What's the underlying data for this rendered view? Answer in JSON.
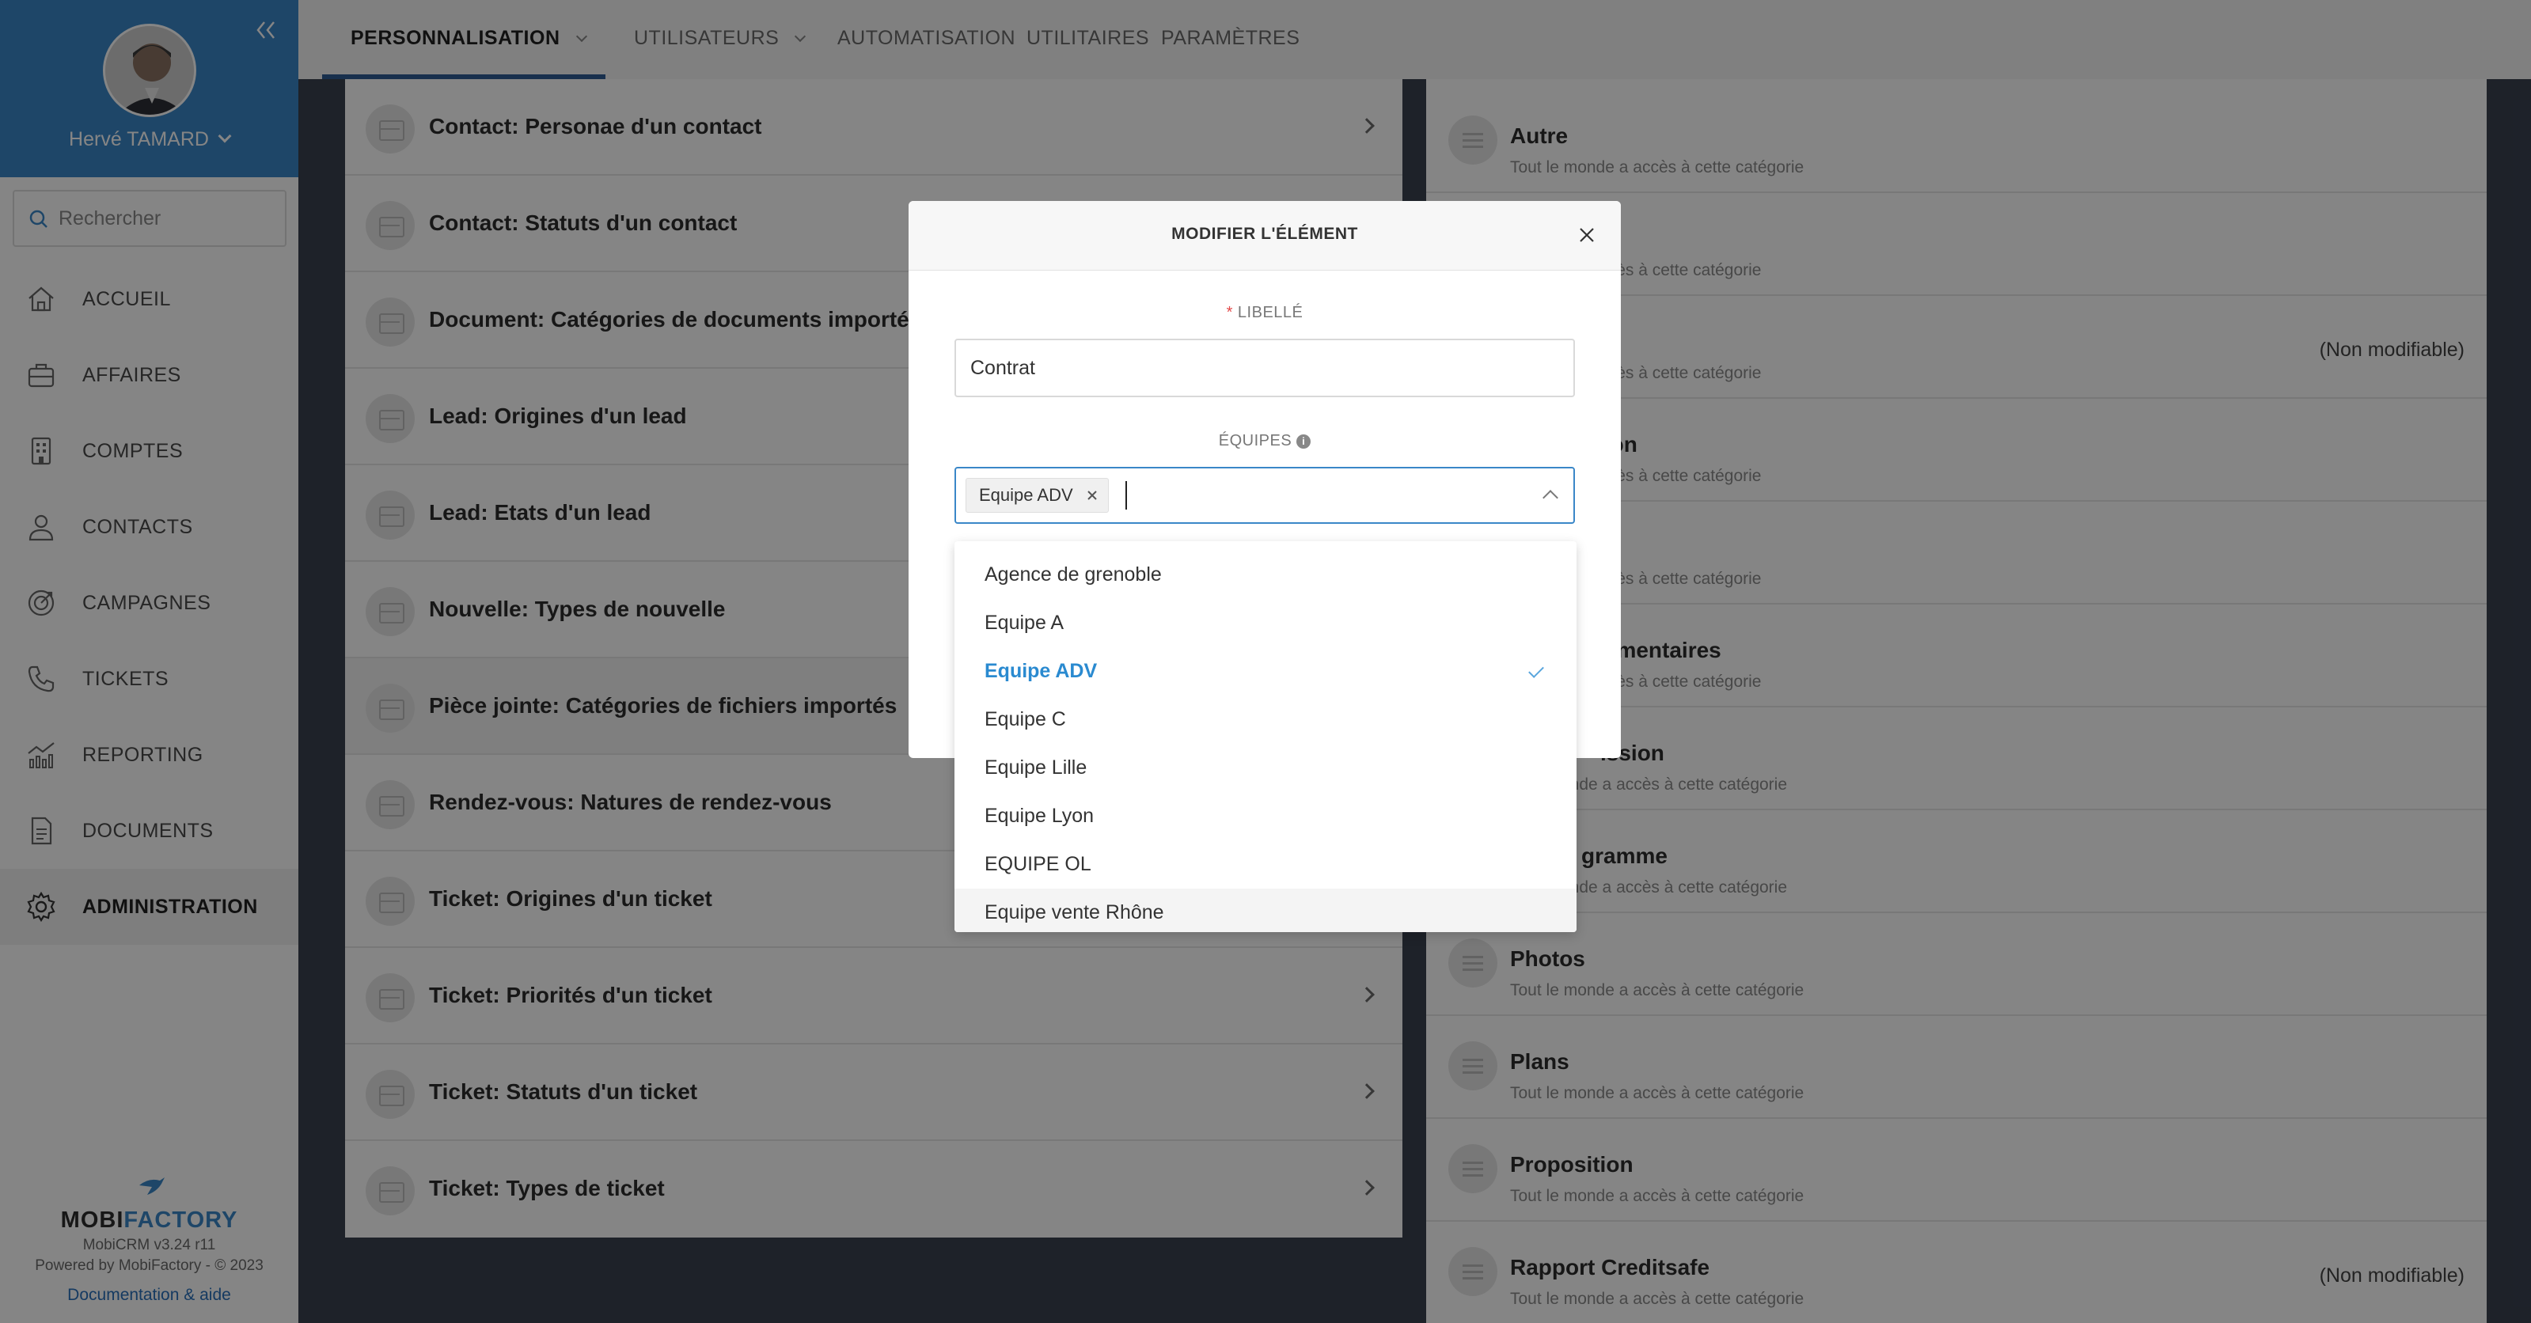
{
  "sidebar": {
    "user": {
      "name": "Hervé TAMARD"
    },
    "search": {
      "placeholder": "Rechercher"
    },
    "nav": [
      {
        "label": "ACCUEIL",
        "icon": "home-icon"
      },
      {
        "label": "AFFAIRES",
        "icon": "briefcase-icon"
      },
      {
        "label": "COMPTES",
        "icon": "building-icon"
      },
      {
        "label": "CONTACTS",
        "icon": "person-icon"
      },
      {
        "label": "CAMPAGNES",
        "icon": "target-icon"
      },
      {
        "label": "TICKETS",
        "icon": "phone-icon"
      },
      {
        "label": "REPORTING",
        "icon": "chart-icon"
      },
      {
        "label": "DOCUMENTS",
        "icon": "document-icon"
      },
      {
        "label": "ADMINISTRATION",
        "icon": "gear-icon",
        "active": true
      }
    ],
    "brand": {
      "name_a": "MOBI",
      "name_b": "FACTORY",
      "version": "MobiCRM v3.24 r11",
      "powered": "Powered by MobiFactory - © 2023",
      "docs": "Documentation & aide"
    }
  },
  "topnav": {
    "tabs": [
      {
        "label": "PERSONNALISATION",
        "active": true,
        "dropdown": true
      },
      {
        "label": "UTILISATEURS",
        "dropdown": true
      },
      {
        "label": "AUTOMATISATION"
      },
      {
        "label": "UTILITAIRES"
      },
      {
        "label": "PARAMÈTRES"
      }
    ]
  },
  "list": {
    "items": [
      "Contact: Personae d'un contact",
      "Contact: Statuts d'un contact",
      "Document: Catégories de documents importés",
      "Lead: Origines d'un lead",
      "Lead: Etats d'un lead",
      "Nouvelle: Types de nouvelle",
      "Pièce jointe: Catégories de fichiers importés",
      "Rendez-vous: Natures de rendez-vous",
      "Ticket: Origines d'un ticket",
      "Ticket: Priorités d'un ticket",
      "Ticket: Statuts d'un ticket",
      "Ticket: Types de ticket"
    ]
  },
  "categories": {
    "items": [
      {
        "title": "Autre",
        "sub": "Tout le monde a accès à cette catégorie",
        "note": ""
      },
      {
        "title": "",
        "sub": "a accès à cette catégorie",
        "note": ""
      },
      {
        "title": "",
        "sub": "a accès à cette catégorie",
        "note": "(Non modifiable)"
      },
      {
        "title": "ation",
        "sub": "a accès à cette catégorie",
        "note": ""
      },
      {
        "title": "",
        "sub": "a accès à cette catégorie",
        "note": ""
      },
      {
        "title": "glementaires",
        "sub": "a accès à cette catégorie",
        "note": ""
      },
      {
        "title": "ission",
        "sub": "onde a accès à cette catégorie",
        "note": ""
      },
      {
        "title": "gramme",
        "sub": "onde a accès à cette catégorie",
        "note": ""
      },
      {
        "title": "Photos",
        "sub": "Tout le monde a accès à cette catégorie",
        "note": ""
      },
      {
        "title": "Plans",
        "sub": "Tout le monde a accès à cette catégorie",
        "note": ""
      },
      {
        "title": "Proposition",
        "sub": "Tout le monde a accès à cette catégorie",
        "note": ""
      },
      {
        "title": "Rapport Creditsafe",
        "sub": "Tout le monde a accès à cette catégorie",
        "note": "(Non modifiable)"
      }
    ]
  },
  "modal": {
    "title": "MODIFIER L'ÉLÉMENT",
    "libelle_label": "LIBELLÉ",
    "libelle_value": "Contrat",
    "equipes_label": "ÉQUIPES",
    "selected_tag": "Equipe ADV",
    "options": [
      {
        "label": "Agence de grenoble"
      },
      {
        "label": "Equipe A"
      },
      {
        "label": "Equipe ADV",
        "selected": true
      },
      {
        "label": "Equipe C"
      },
      {
        "label": "Equipe Lille"
      },
      {
        "label": "Equipe Lyon"
      },
      {
        "label": "EQUIPE OL"
      },
      {
        "label": "Equipe vente Rhône",
        "hovered": true
      }
    ]
  },
  "colors": {
    "accent": "#3a87c8",
    "selected_option": "#2a8ad0",
    "required": "#e24848"
  }
}
